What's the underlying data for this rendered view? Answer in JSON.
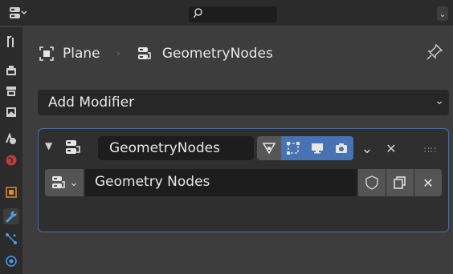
{
  "topbar": {
    "editor_type_icon": "properties-editor-icon",
    "search_placeholder": "",
    "menu_icon": "chevron-down-icon"
  },
  "tabs": [
    {
      "icon": "tool-icon",
      "active": false
    },
    {
      "icon": "render-icon",
      "active": false
    },
    {
      "icon": "output-icon",
      "active": false
    },
    {
      "icon": "view-layer-icon",
      "active": false
    },
    {
      "icon": "scene-icon",
      "active": false
    },
    {
      "icon": "world-icon",
      "active": false
    },
    {
      "icon": "object-icon",
      "active": false
    },
    {
      "icon": "modifier-wrench-icon",
      "active": true
    },
    {
      "icon": "particles-icon",
      "active": false
    },
    {
      "icon": "physics-icon",
      "active": false
    }
  ],
  "breadcrumb": {
    "object_label": "Plane",
    "modifier_label": "GeometryNodes"
  },
  "add_modifier": {
    "label": "Add Modifier"
  },
  "modifier": {
    "name": "GeometryNodes",
    "toggles": {
      "edit_mode_cage": false,
      "edit_mode": true,
      "viewport": true,
      "render": true
    },
    "node_group": "Geometry Nodes"
  },
  "colors": {
    "accent": "#4772b3",
    "panel": "#3d3d3d",
    "field": "#1d1d1d",
    "card_border": "#4a6fa5"
  }
}
